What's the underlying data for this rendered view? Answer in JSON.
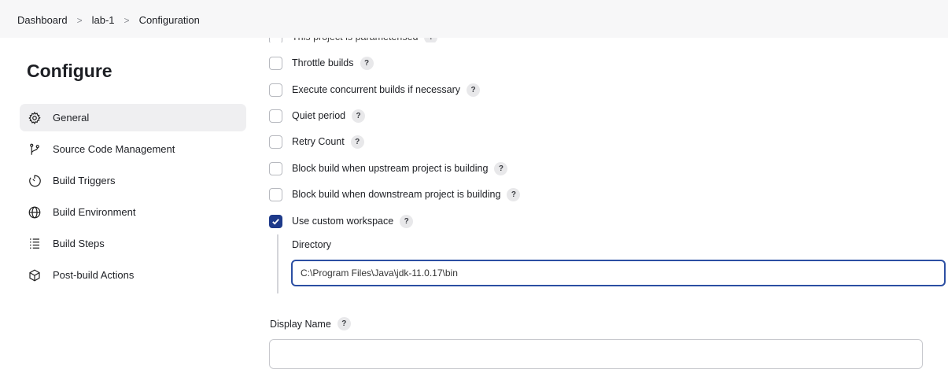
{
  "breadcrumb": {
    "items": [
      "Dashboard",
      "lab-1",
      "Configuration"
    ],
    "separator": ">"
  },
  "sidebar": {
    "title": "Configure",
    "items": [
      {
        "label": "General",
        "icon": "gear-icon",
        "active": true
      },
      {
        "label": "Source Code Management",
        "icon": "branch-icon"
      },
      {
        "label": "Build Triggers",
        "icon": "timer-icon"
      },
      {
        "label": "Build Environment",
        "icon": "globe-icon"
      },
      {
        "label": "Build Steps",
        "icon": "list-icon"
      },
      {
        "label": "Post-build Actions",
        "icon": "package-icon"
      }
    ]
  },
  "options": [
    {
      "label": "This project is parameterised",
      "checked": false
    },
    {
      "label": "Throttle builds",
      "checked": false
    },
    {
      "label": "Execute concurrent builds if necessary",
      "checked": false
    },
    {
      "label": "Quiet period",
      "checked": false
    },
    {
      "label": "Retry Count",
      "checked": false
    },
    {
      "label": "Block build when upstream project is building",
      "checked": false
    },
    {
      "label": "Block build when downstream project is building",
      "checked": false
    },
    {
      "label": "Use custom workspace",
      "checked": true
    }
  ],
  "help_glyph": "?",
  "workspace": {
    "directory_label": "Directory",
    "directory_value": "C:\\Program Files\\Java\\jdk-11.0.17\\bin"
  },
  "display_name": {
    "label": "Display Name",
    "value": ""
  },
  "colors": {
    "accent": "#1e3a8a",
    "focus_border": "#2c4fa3"
  }
}
